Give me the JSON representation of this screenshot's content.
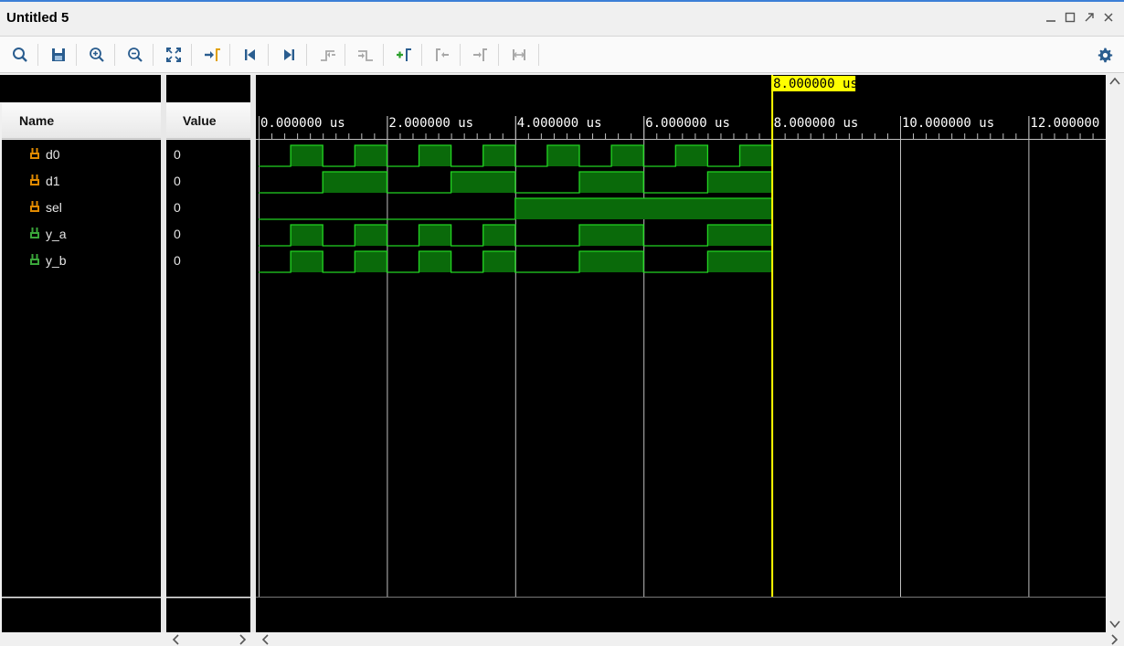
{
  "window": {
    "title": "Untitled 5"
  },
  "toolbar": {
    "buttons": [
      {
        "name": "search-button",
        "icon": "search-icon"
      },
      {
        "name": "save-button",
        "icon": "save-icon"
      },
      {
        "name": "zoom-in-button",
        "icon": "zoom-in-icon"
      },
      {
        "name": "zoom-out-button",
        "icon": "zoom-out-icon"
      },
      {
        "name": "zoom-fit-button",
        "icon": "zoom-fit-icon"
      },
      {
        "name": "go-to-cursor-button",
        "icon": "go-to-cursor-icon"
      },
      {
        "name": "go-to-time-zero-button",
        "icon": "go-to-start-icon"
      },
      {
        "name": "go-to-last-time-button",
        "icon": "go-to-end-icon"
      },
      {
        "name": "previous-transition-button",
        "icon": "previous-transition-icon"
      },
      {
        "name": "next-transition-button",
        "icon": "next-transition-icon"
      },
      {
        "name": "add-marker-button",
        "icon": "add-marker-icon"
      },
      {
        "name": "previous-marker-button",
        "icon": "previous-marker-icon"
      },
      {
        "name": "next-marker-button",
        "icon": "next-marker-icon"
      },
      {
        "name": "swap-cursors-button",
        "icon": "swap-cursors-icon"
      },
      {
        "name": "settings-button",
        "icon": "gear-icon"
      }
    ]
  },
  "columns": {
    "name_header": "Name",
    "value_header": "Value"
  },
  "signals": [
    {
      "name": "d0",
      "value": "0",
      "kind": "input"
    },
    {
      "name": "d1",
      "value": "0",
      "kind": "input"
    },
    {
      "name": "sel",
      "value": "0",
      "kind": "input"
    },
    {
      "name": "y_a",
      "value": "0",
      "kind": "output"
    },
    {
      "name": "y_b",
      "value": "0",
      "kind": "output"
    }
  ],
  "timeline": {
    "unit": "us",
    "tick_labels": [
      "0.000000 us",
      "2.000000 us",
      "4.000000 us",
      "6.000000 us",
      "8.000000 us",
      "10.000000 us",
      "12.000000 us"
    ],
    "ticks_us": [
      0,
      2,
      4,
      6,
      8,
      10,
      12
    ],
    "cursor_label": "8.000000 us",
    "cursor_time_us": 8,
    "sim_end_us": 8
  },
  "waveforms": {
    "d0": [
      [
        0,
        0
      ],
      [
        0.5,
        1
      ],
      [
        1,
        0
      ],
      [
        1.5,
        1
      ],
      [
        2,
        0
      ],
      [
        2.5,
        1
      ],
      [
        3,
        0
      ],
      [
        3.5,
        1
      ],
      [
        4,
        0
      ],
      [
        4.5,
        1
      ],
      [
        5,
        0
      ],
      [
        5.5,
        1
      ],
      [
        6,
        0
      ],
      [
        6.5,
        1
      ],
      [
        7,
        0
      ],
      [
        7.5,
        1
      ],
      [
        8,
        null
      ]
    ],
    "d1": [
      [
        0,
        0
      ],
      [
        1,
        1
      ],
      [
        2,
        0
      ],
      [
        3,
        1
      ],
      [
        4,
        0
      ],
      [
        5,
        1
      ],
      [
        6,
        0
      ],
      [
        7,
        1
      ],
      [
        8,
        null
      ]
    ],
    "sel": [
      [
        0,
        0
      ],
      [
        4,
        1
      ],
      [
        8,
        null
      ]
    ],
    "y_a": [
      [
        0,
        0
      ],
      [
        0.5,
        1
      ],
      [
        1,
        0
      ],
      [
        1.5,
        1
      ],
      [
        2,
        0
      ],
      [
        2.5,
        1
      ],
      [
        3,
        0
      ],
      [
        3.5,
        1
      ],
      [
        4,
        0
      ],
      [
        5,
        1
      ],
      [
        6,
        0
      ],
      [
        7,
        1
      ],
      [
        8,
        null
      ]
    ],
    "y_b": [
      [
        0,
        0
      ],
      [
        0.5,
        1
      ],
      [
        1,
        0
      ],
      [
        1.5,
        1
      ],
      [
        2,
        0
      ],
      [
        2.5,
        1
      ],
      [
        3,
        0
      ],
      [
        3.5,
        1
      ],
      [
        4,
        0
      ],
      [
        5,
        1
      ],
      [
        6,
        0
      ],
      [
        7,
        1
      ],
      [
        8,
        null
      ]
    ]
  },
  "colors": {
    "wave_line": "#22d422",
    "wave_fill": "#0a6a0a",
    "cursor": "#ffff00",
    "grid": "#bfbfbf",
    "background": "#000000",
    "text": "#ffffff"
  }
}
